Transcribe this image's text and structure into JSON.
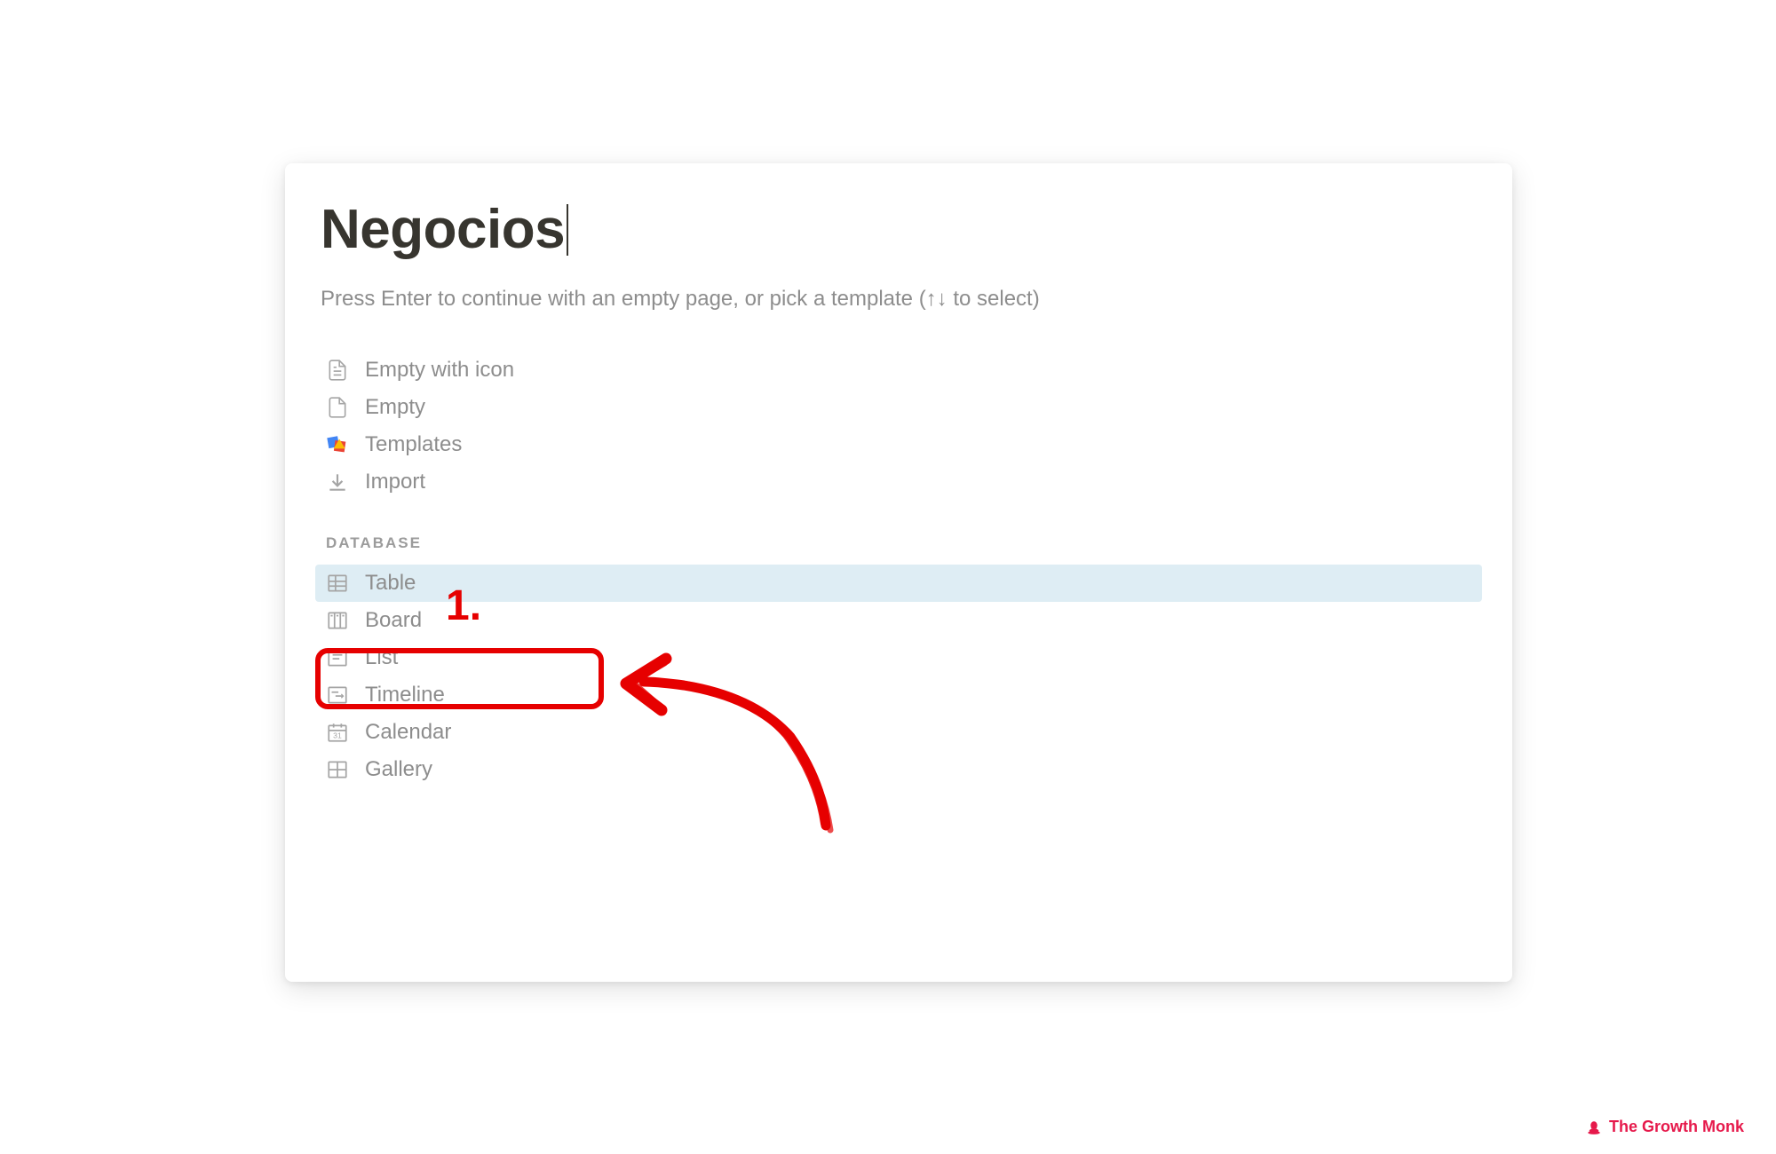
{
  "page": {
    "title": "Negocios",
    "subtitle": "Press Enter to continue with an empty page, or pick a template (↑↓ to select)"
  },
  "options": {
    "empty_with_icon": "Empty with icon",
    "empty": "Empty",
    "templates": "Templates",
    "import": "Import"
  },
  "database_section": {
    "header": "DATABASE",
    "table": "Table",
    "board": "Board",
    "list": "List",
    "timeline": "Timeline",
    "calendar": "Calendar",
    "gallery": "Gallery"
  },
  "annotation": {
    "number": "1."
  },
  "footer": {
    "brand": "The Growth Monk"
  }
}
